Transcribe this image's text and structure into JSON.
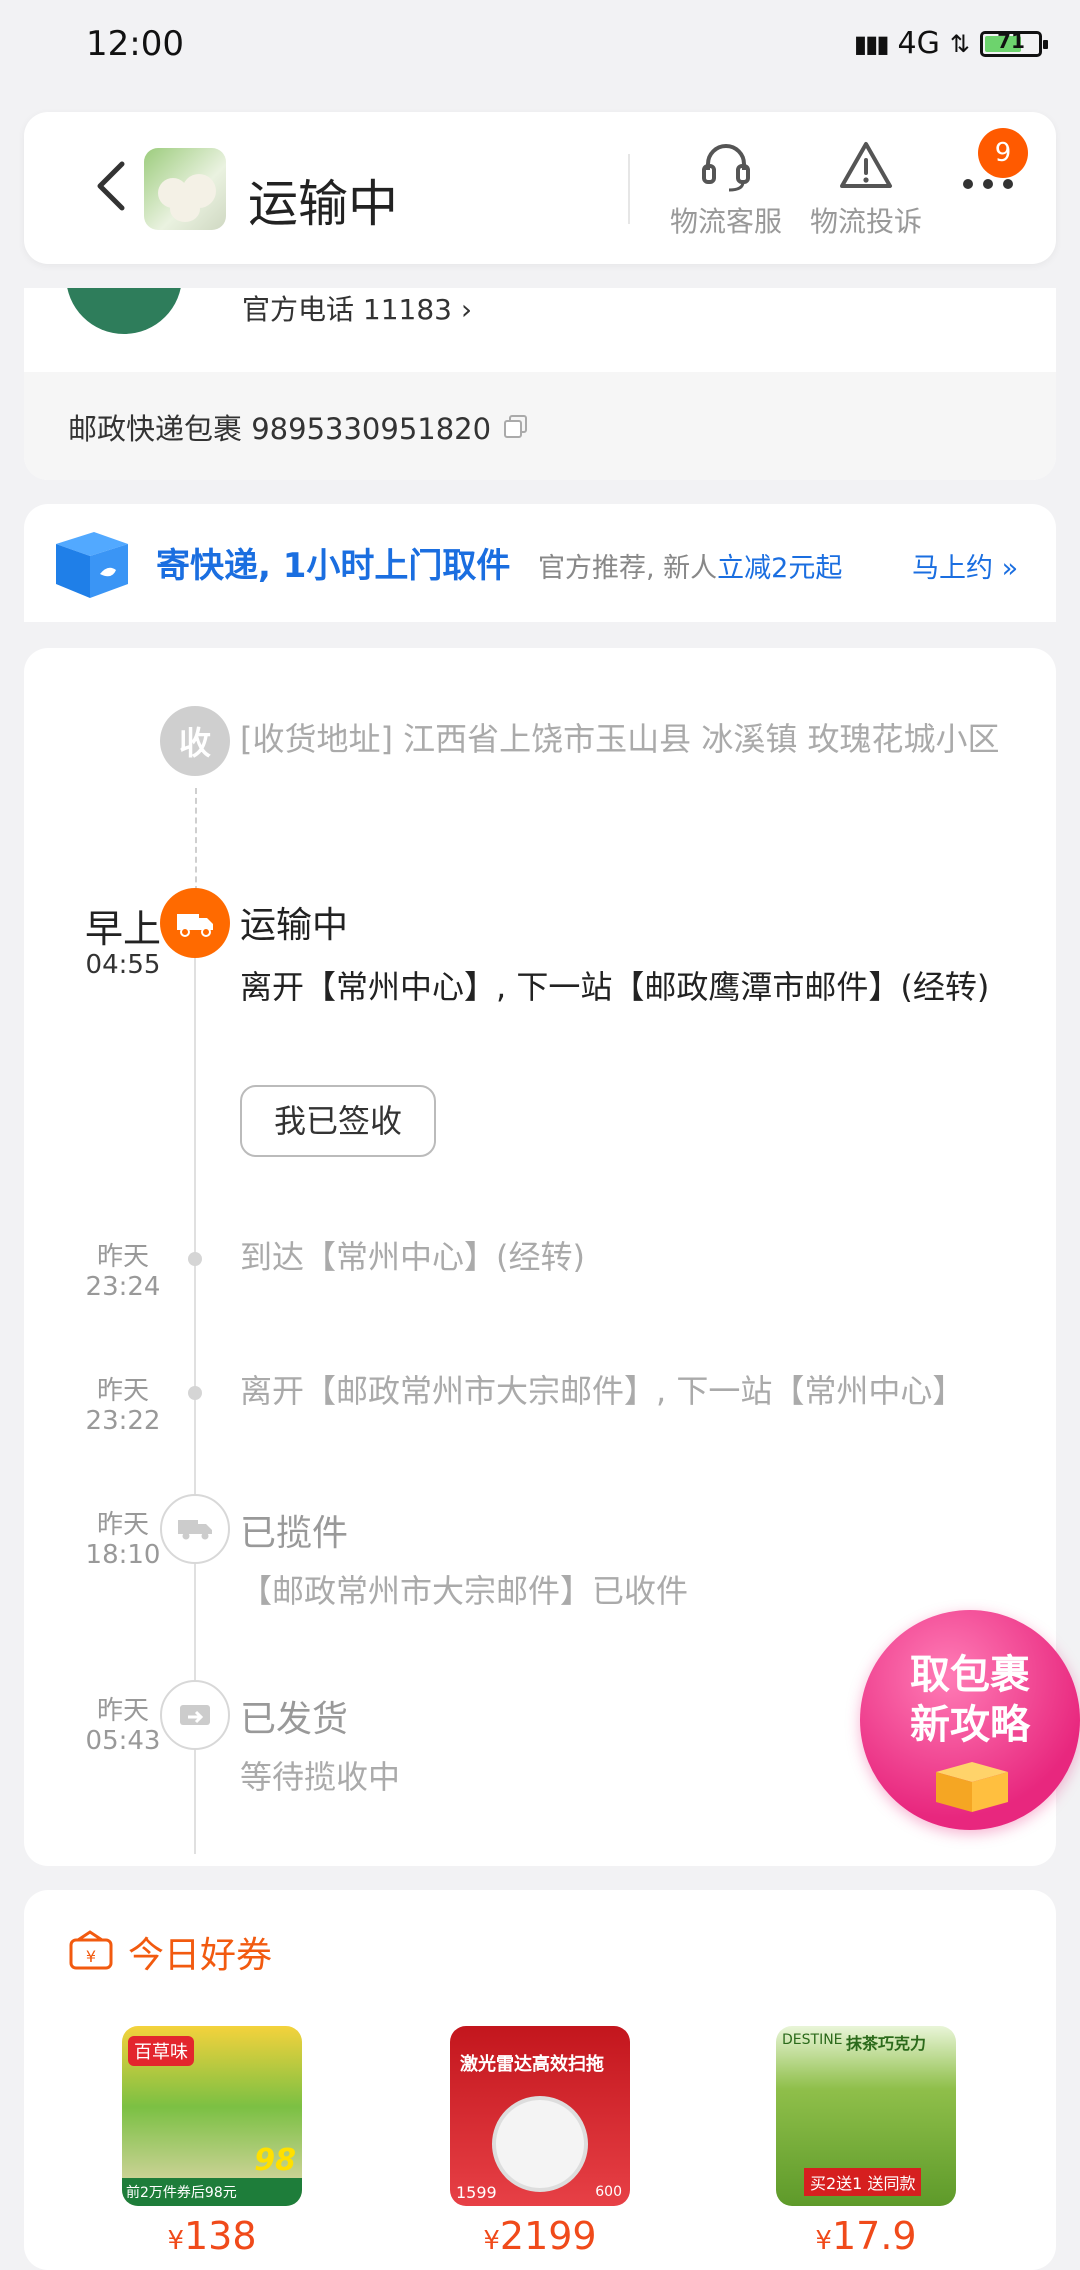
{
  "status_bar": {
    "time": "12:00",
    "network": "4G",
    "battery": "71",
    "battery_level": 0.71
  },
  "header": {
    "title": "运输中",
    "service_label": "物流客服",
    "complaint_label": "物流投诉",
    "badge_count": "9"
  },
  "package": {
    "phone_text": "官方电话 11183",
    "tracking_text": "邮政快递包裹 9895330951820"
  },
  "promo": {
    "main": "寄快递, 1小时上门取件",
    "sub_prefix": "官方推荐, 新人",
    "sub_highlight": "立减2元起",
    "cta": "马上约"
  },
  "tracking": {
    "receive_node_label": "收",
    "address": "[收货地址] 江西省上饶市玉山县 冰溪镇   玫瑰花城小区",
    "events": [
      {
        "day": "早上",
        "time": "04:55",
        "status": "运输中",
        "detail": "离开【常州中心】, 下一站【邮政鹰潭市邮件】(经转)"
      },
      {
        "day": "昨天",
        "time": "23:24",
        "detail": "到达【常州中心】(经转)"
      },
      {
        "day": "昨天",
        "time": "23:22",
        "detail": "离开【邮政常州市大宗邮件】, 下一站【常州中心】"
      },
      {
        "day": "昨天",
        "time": "18:10",
        "status": "已揽件",
        "detail": "【邮政常州市大宗邮件】已收件"
      },
      {
        "day": "昨天",
        "time": "05:43",
        "status": "已发货",
        "detail": "等待揽收中"
      }
    ],
    "sign_button": "我已签收"
  },
  "bubble": {
    "line1": "取包裹",
    "line2": "新攻略"
  },
  "coupons": {
    "title": "今日好券",
    "items": [
      {
        "price": "138",
        "img_label": "百草味",
        "img_promo": "前2万件券后98元",
        "img_big": "98"
      },
      {
        "price": "2199",
        "img_label": "激光雷达高效扫拖",
        "img_promo": "1599",
        "img_big": "600"
      },
      {
        "price": "17.9",
        "img_label": "抹茶巧克力",
        "img_promo": "买2送1 送同款",
        "img_big": "DESTINE"
      }
    ],
    "currency": "¥"
  },
  "colors": {
    "accent_orange": "#ff6a00",
    "accent_blue": "#1a6ee0",
    "price_red": "#f04a1a"
  }
}
